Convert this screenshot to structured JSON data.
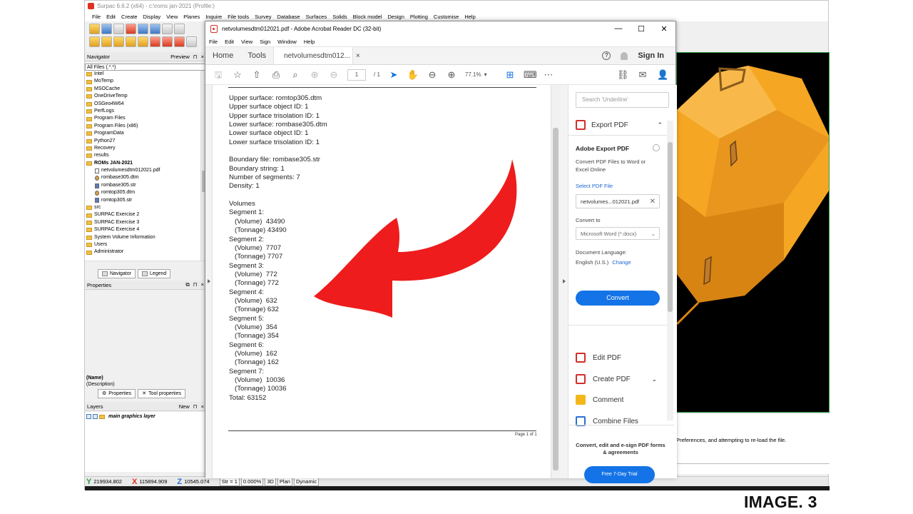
{
  "surpac": {
    "title": "Surpac 6.6.2 (x64) - c:\\roms jan-2021 (Profile:)",
    "menu": [
      "File",
      "Edit",
      "Create",
      "Display",
      "View",
      "Planes",
      "Inquire",
      "File tools",
      "Survey",
      "Database",
      "Surfaces",
      "Solids",
      "Block model",
      "Design",
      "Plotting",
      "Customise",
      "Help"
    ],
    "navigator": {
      "title": "Navigator",
      "preview_label": "Preview",
      "filter": "All Files (.*.*)",
      "tree": [
        {
          "label": "Intel",
          "type": "folder",
          "indent": 0
        },
        {
          "label": "MoTemp",
          "type": "folder",
          "indent": 0
        },
        {
          "label": "MSOCache",
          "type": "folder",
          "indent": 0
        },
        {
          "label": "OneDriveTemp",
          "type": "folder",
          "indent": 0
        },
        {
          "label": "OSGeo4W64",
          "type": "folder",
          "indent": 0
        },
        {
          "label": "PerfLogs",
          "type": "folder",
          "indent": 0
        },
        {
          "label": "Program Files",
          "type": "folder",
          "indent": 0
        },
        {
          "label": "Program Files (x86)",
          "type": "folder",
          "indent": 0
        },
        {
          "label": "ProgramData",
          "type": "folder",
          "indent": 0
        },
        {
          "label": "Python27",
          "type": "folder",
          "indent": 0
        },
        {
          "label": "Recovery",
          "type": "folder",
          "indent": 0
        },
        {
          "label": "results",
          "type": "folder",
          "indent": 0
        },
        {
          "label": "ROMs JAN-2021",
          "type": "folder",
          "indent": 0,
          "bold": true
        },
        {
          "label": "netvolumesdtm012021.pdf",
          "type": "file",
          "indent": 1
        },
        {
          "label": "rombase305.dtm",
          "type": "dtm",
          "indent": 1
        },
        {
          "label": "rombase305.str",
          "type": "str",
          "indent": 1
        },
        {
          "label": "romtop305.dtm",
          "type": "dtm",
          "indent": 1
        },
        {
          "label": "romtop305.str",
          "type": "str",
          "indent": 1
        },
        {
          "label": "src",
          "type": "folder",
          "indent": 0
        },
        {
          "label": "SURPAC Exercise 2",
          "type": "folder",
          "indent": 0
        },
        {
          "label": "SURPAC Exercise 3",
          "type": "folder",
          "indent": 0
        },
        {
          "label": "SURPAC Exercise 4",
          "type": "folder",
          "indent": 0
        },
        {
          "label": "System Volume Information",
          "type": "folder",
          "indent": 0
        },
        {
          "label": "Users",
          "type": "folder",
          "indent": 0
        },
        {
          "label": "Administrator",
          "type": "folder",
          "indent": 0
        }
      ],
      "tab_navigator": "Navigator",
      "tab_legend": "Legend"
    },
    "properties": {
      "title": "Properties",
      "name_label": "(Name)",
      "desc_label": "(Description)",
      "tab_properties": "Properties",
      "tab_tool_properties": "Tool properties"
    },
    "layers": {
      "title": "Layers",
      "new_label": "New",
      "layer_name": "main graphics layer"
    },
    "output_text": "Preferences, and attempting to re-load the file.",
    "status": {
      "y": "219934.802",
      "x": "115894.909",
      "z": "10545.074",
      "str": "Str = 1",
      "zoom": "0.000%",
      "btn_3d": "3D",
      "btn_plan": "Plan",
      "btn_dynamic": "Dynamic"
    }
  },
  "acrobat": {
    "title": "netvolumesdtm012021.pdf - Adobe Acrobat Reader DC (32-bit)",
    "menu": [
      "File",
      "Edit",
      "View",
      "Sign",
      "Window",
      "Help"
    ],
    "tab_home": "Home",
    "tab_tools": "Tools",
    "tab_doc": "netvolumesdtm012...",
    "sign_in": "Sign In",
    "page_current": "1",
    "page_of": "/ 1",
    "zoom": "77.1%",
    "doc_lines": [
      "Upper surface: romtop305.dtm",
      "Upper surface object ID: 1",
      "Upper surface trisolation ID: 1",
      "Lower surface: rombase305.dtm",
      "Lower surface object ID: 1",
      "Lower surface trisolation ID: 1",
      "",
      "Boundary file: rombase305.str",
      "Boundary string: 1",
      "Number of segments: 7",
      "Density: 1",
      "",
      "Volumes",
      "Segment 1:",
      "   (Volume)  43490",
      "   (Tonnage) 43490",
      "Segment 2:",
      "   (Volume)  7707",
      "   (Tonnage) 7707",
      "Segment 3:",
      "   (Volume)  772",
      "   (Tonnage) 772",
      "Segment 4:",
      "   (Volume)  632",
      "   (Tonnage) 632",
      "Segment 5:",
      "   (Volume)  354",
      "   (Tonnage) 354",
      "Segment 6:",
      "   (Volume)  162",
      "   (Tonnage) 162",
      "Segment 7:",
      "   (Volume)  10036",
      "   (Tonnage) 10036",
      "Total: 63152"
    ],
    "page_footer": "Page 1 of 1",
    "right_pane": {
      "search_placeholder": "Search 'Underline'",
      "export_pdf": "Export PDF",
      "export_title": "Adobe Export PDF",
      "export_desc": "Convert PDF Files to Word or Excel Online",
      "select_pdf": "Select PDF File",
      "selected_file": "netvolumes...012021.pdf",
      "convert_to": "Convert to",
      "format": "Microsoft Word (*.docx)",
      "doc_language": "Document Language:",
      "language": "English (U.S.)",
      "change": "Change",
      "convert_button": "Convert",
      "edit_pdf": "Edit PDF",
      "create_pdf": "Create PDF",
      "comment": "Comment",
      "combine_files": "Combine Files",
      "promo": "Convert, edit and e-sign PDF forms & agreements",
      "trial_button": "Free 7-Day Trial"
    }
  },
  "caption": "IMAGE. 3",
  "colors": {
    "acrobat_blue": "#1473e6",
    "annotation_red": "#ee1c1c",
    "surface_orange": "#f5a623"
  }
}
